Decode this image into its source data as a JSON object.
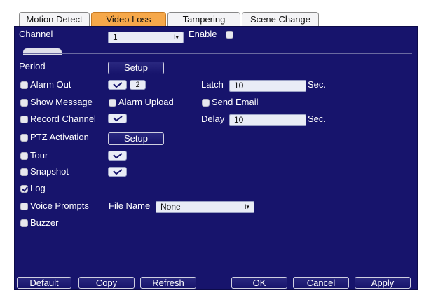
{
  "tabs": [
    {
      "label": "Motion Detect",
      "active": false
    },
    {
      "label": "Video Loss",
      "active": true
    },
    {
      "label": "Tampering",
      "active": false
    },
    {
      "label": "Scene Change",
      "active": false
    }
  ],
  "channel": {
    "label": "Channel",
    "value": "1"
  },
  "enable": {
    "label": "Enable",
    "checked": false
  },
  "period": {
    "label": "Period",
    "button": "Setup"
  },
  "alarm_out": {
    "label": "Alarm Out",
    "checked": false,
    "value": "2"
  },
  "latch": {
    "label": "Latch",
    "value": "10",
    "unit": "Sec."
  },
  "show_message": {
    "label": "Show Message",
    "checked": false
  },
  "alarm_upload": {
    "label": "Alarm Upload",
    "checked": false
  },
  "send_email": {
    "label": "Send Email",
    "checked": false
  },
  "record_channel": {
    "label": "Record Channel",
    "checked": false
  },
  "delay": {
    "label": "Delay",
    "value": "10",
    "unit": "Sec."
  },
  "ptz_activation": {
    "label": "PTZ Activation",
    "checked": false,
    "button": "Setup"
  },
  "tour": {
    "label": "Tour",
    "checked": false
  },
  "snapshot": {
    "label": "Snapshot",
    "checked": false
  },
  "log": {
    "label": "Log",
    "checked": true
  },
  "voice_prompts": {
    "label": "Voice Prompts",
    "checked": false,
    "file_label": "File Name",
    "file_value": "None"
  },
  "buzzer": {
    "label": "Buzzer",
    "checked": false
  },
  "footer": {
    "default": "Default",
    "copy": "Copy",
    "refresh": "Refresh",
    "ok": "OK",
    "cancel": "Cancel",
    "apply": "Apply"
  },
  "colors": {
    "panel": "#17146c",
    "active_tab": "#f6a84a"
  }
}
